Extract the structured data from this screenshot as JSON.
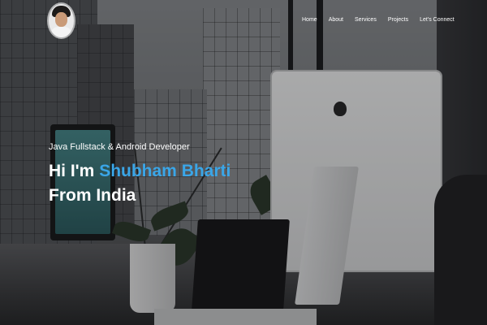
{
  "nav": {
    "items": [
      {
        "label": "Home"
      },
      {
        "label": "About"
      },
      {
        "label": "Services"
      },
      {
        "label": "Projects"
      },
      {
        "label": "Let's Connect"
      }
    ]
  },
  "avatar": {
    "icon": "profile-photo"
  },
  "hero": {
    "subtitle": "Java Fullstack & Android Developer",
    "greeting": "Hi I'm",
    "name": "Shubham Bharti",
    "location_line": "From India",
    "name_color": "#3aa6e8"
  }
}
